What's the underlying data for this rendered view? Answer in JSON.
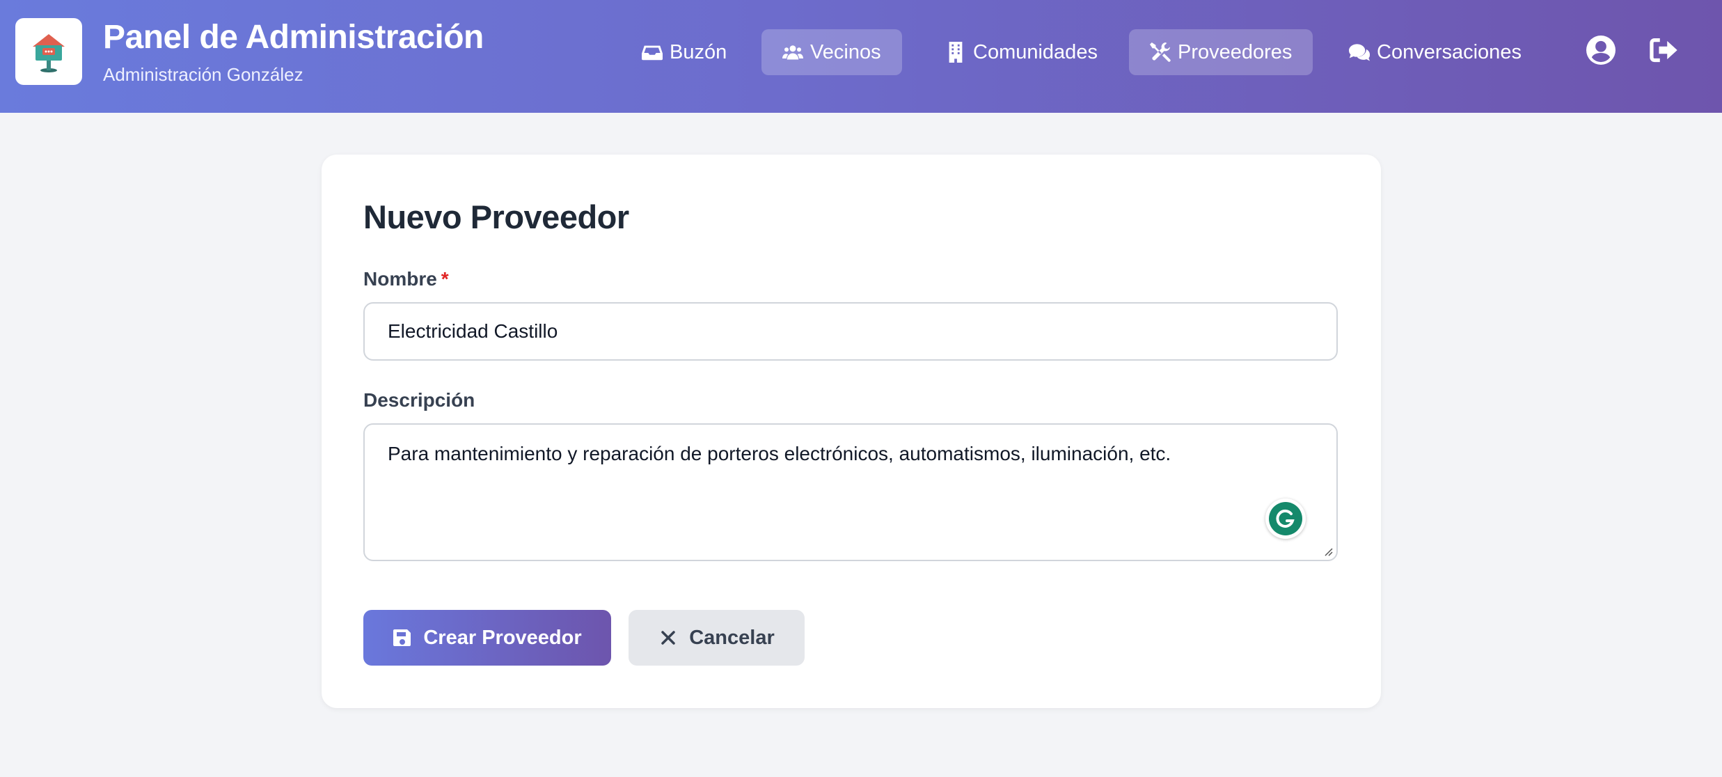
{
  "header": {
    "title": "Panel de Administración",
    "subtitle": "Administración González",
    "logo_icon": "house-mailbox-icon",
    "nav": [
      {
        "label": "Buzón",
        "icon": "inbox-icon",
        "active": false
      },
      {
        "label": "Vecinos",
        "icon": "users-icon",
        "active": true
      },
      {
        "label": "Comunidades",
        "icon": "building-icon",
        "active": false
      },
      {
        "label": "Proveedores",
        "icon": "tools-icon",
        "active": true
      },
      {
        "label": "Conversaciones",
        "icon": "comments-icon",
        "active": false
      }
    ],
    "user_icon": "user-circle-icon",
    "logout_icon": "sign-out-icon",
    "gradient": [
      "#6a7bdc",
      "#6e55ad"
    ]
  },
  "form": {
    "title": "Nuevo Proveedor",
    "name_label": "Nombre",
    "required_mark": "*",
    "name_value": "Electricidad Castillo",
    "description_label": "Descripción",
    "description_value": "Para mantenimiento y reparación de porteros electrónicos, automatismos, iluminación, etc.",
    "submit_label": "Crear Proveedor",
    "submit_icon": "save-icon",
    "cancel_label": "Cancelar",
    "cancel_icon": "close-icon"
  },
  "colors": {
    "page_bg": "#f3f4f7",
    "required": "#e02424",
    "grammarly": "#15896b"
  }
}
